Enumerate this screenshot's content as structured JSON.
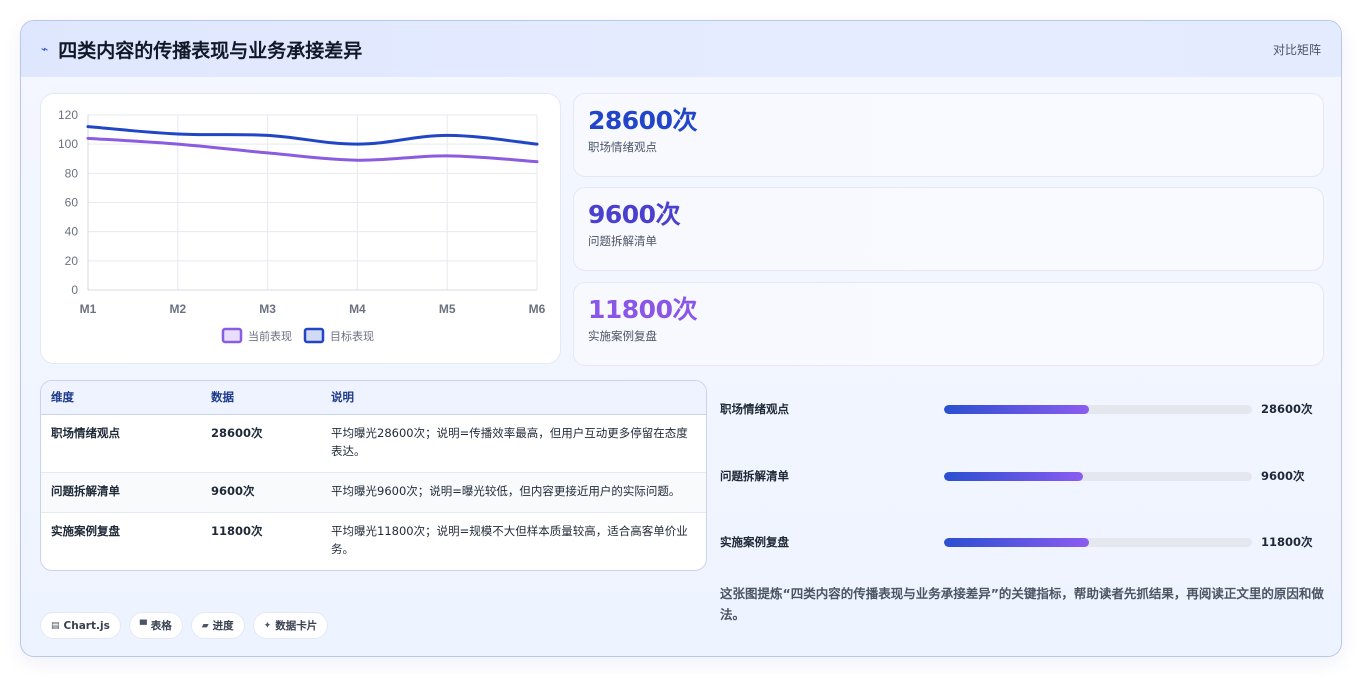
{
  "header": {
    "icon": "chart-line-icon",
    "title": "四类内容的传播表现与业务承接差异",
    "right_label": "对比矩阵"
  },
  "chart_data": {
    "type": "line",
    "categories": [
      "M1",
      "M2",
      "M3",
      "M4",
      "M5",
      "M6"
    ],
    "ylim": [
      0,
      120
    ],
    "yticks": [
      0,
      20,
      40,
      60,
      80,
      100,
      120
    ],
    "series": [
      {
        "name": "当前表现",
        "values": [
          104,
          100,
          94,
          89,
          92,
          88
        ],
        "color": "#8b5cdf"
      },
      {
        "name": "目标表现",
        "values": [
          112,
          107,
          106,
          100,
          106,
          100
        ],
        "color": "#2046c5"
      }
    ],
    "grid": true,
    "legend": "bottom"
  },
  "kpis": [
    {
      "value": "28600次",
      "label": "职场情绪观点",
      "color": "#2345c9"
    },
    {
      "value": "9600次",
      "label": "问题拆解清单",
      "color": "#4a3fcf"
    },
    {
      "value": "11800次",
      "label": "实施案例复盘",
      "color": "#8a56e8"
    }
  ],
  "table": {
    "headers": [
      "维度",
      "数据",
      "说明"
    ],
    "rows": [
      [
        "职场情绪观点",
        "28600次",
        "平均曝光28600次；说明=传播效率最高，但用户互动更多停留在态度表达。"
      ],
      [
        "问题拆解清单",
        "9600次",
        "平均曝光9600次；说明=曝光较低，但内容更接近用户的实际问题。"
      ],
      [
        "实施案例复盘",
        "11800次",
        "平均曝光11800次；说明=规模不大但样本质量较高，适合高客单价业务。"
      ]
    ]
  },
  "progress": [
    {
      "label": "职场情绪观点",
      "value": "28600次",
      "fraction": 0.47
    },
    {
      "label": "问题拆解清单",
      "value": "9600次",
      "fraction": 0.45
    },
    {
      "label": "实施案例复盘",
      "value": "11800次",
      "fraction": 0.47
    }
  ],
  "summary": "这张图提炼“四类内容的传播表现与业务承接差异”的关键指标，帮助读者先抓结果，再阅读正文里的原因和做法。",
  "chips": [
    {
      "icon": "chart-icon",
      "glyph": "▤",
      "label": "Chart.js"
    },
    {
      "icon": "table-icon",
      "glyph": "▀",
      "label": "表格"
    },
    {
      "icon": "progress-icon",
      "glyph": "▰",
      "label": "进度"
    },
    {
      "icon": "sparkle-icon",
      "glyph": "✦",
      "label": "数据卡片"
    }
  ]
}
